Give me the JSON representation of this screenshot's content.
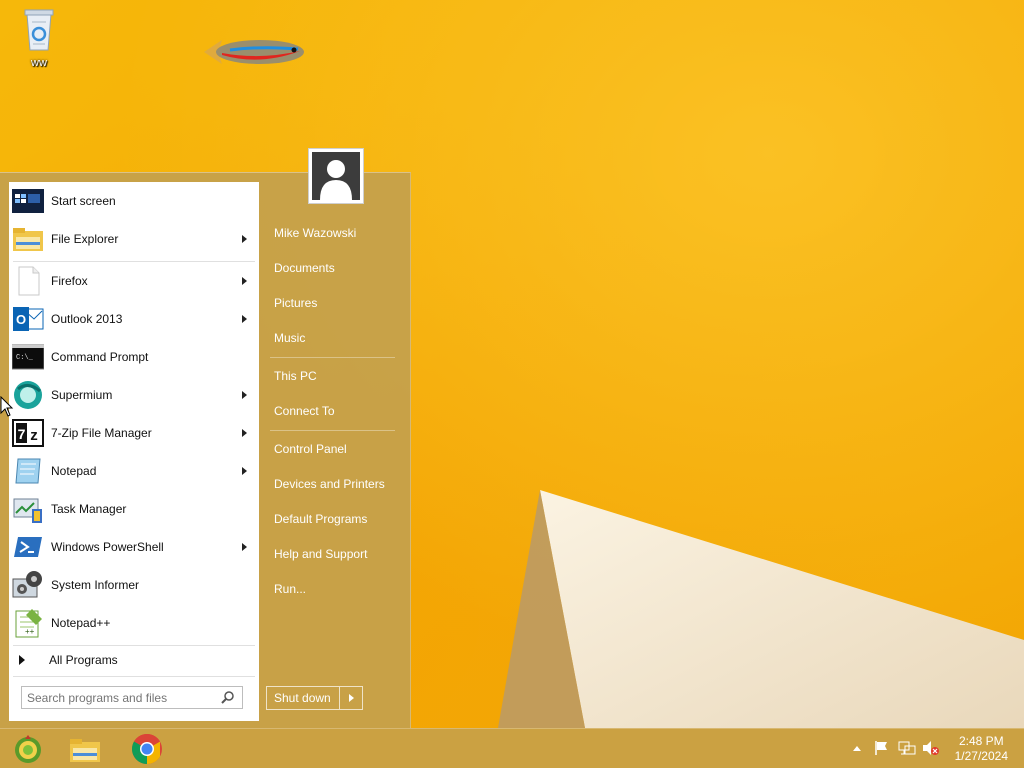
{
  "desktop": {
    "recycle_bin_label": "ww"
  },
  "start_menu": {
    "programs": [
      {
        "label": "Start screen",
        "icon": "start-screen-icon",
        "has_submenu": false
      },
      {
        "label": "File Explorer",
        "icon": "file-explorer-icon",
        "has_submenu": true
      },
      {
        "label": "Firefox",
        "icon": "firefox-icon",
        "has_submenu": true
      },
      {
        "label": "Outlook 2013",
        "icon": "outlook-icon",
        "has_submenu": true
      },
      {
        "label": "Command Prompt",
        "icon": "command-prompt-icon",
        "has_submenu": false
      },
      {
        "label": "Supermium",
        "icon": "supermium-icon",
        "has_submenu": true
      },
      {
        "label": "7-Zip File Manager",
        "icon": "7zip-icon",
        "has_submenu": true
      },
      {
        "label": "Notepad",
        "icon": "notepad-icon",
        "has_submenu": true
      },
      {
        "label": "Task Manager",
        "icon": "task-manager-icon",
        "has_submenu": false
      },
      {
        "label": "Windows PowerShell",
        "icon": "powershell-icon",
        "has_submenu": true
      },
      {
        "label": "System Informer",
        "icon": "system-informer-icon",
        "has_submenu": false
      },
      {
        "label": "Notepad++",
        "icon": "notepad-plus-plus-icon",
        "has_submenu": false
      }
    ],
    "all_programs_label": "All Programs",
    "search_placeholder": "Search programs and files",
    "right_items": {
      "user": "Mike Wazowski",
      "documents": "Documents",
      "pictures": "Pictures",
      "music": "Music",
      "this_pc": "This PC",
      "connect_to": "Connect To",
      "control_panel": "Control Panel",
      "devices_printers": "Devices and Printers",
      "default_programs": "Default Programs",
      "help_support": "Help and Support",
      "run": "Run..."
    },
    "shutdown_label": "Shut down"
  },
  "taskbar": {
    "pinned": [
      "start-orb-icon",
      "file-explorer-icon",
      "chrome-icon"
    ],
    "tray_icons": [
      "show-hidden-icons-icon",
      "action-center-flag-icon",
      "network-icon",
      "volume-muted-icon"
    ],
    "time": "2:48 PM",
    "date": "1/27/2024"
  },
  "colors": {
    "wallpaper": "#f5ad06",
    "menu_background": "#c4a04c",
    "taskbar": "#c8a046"
  }
}
